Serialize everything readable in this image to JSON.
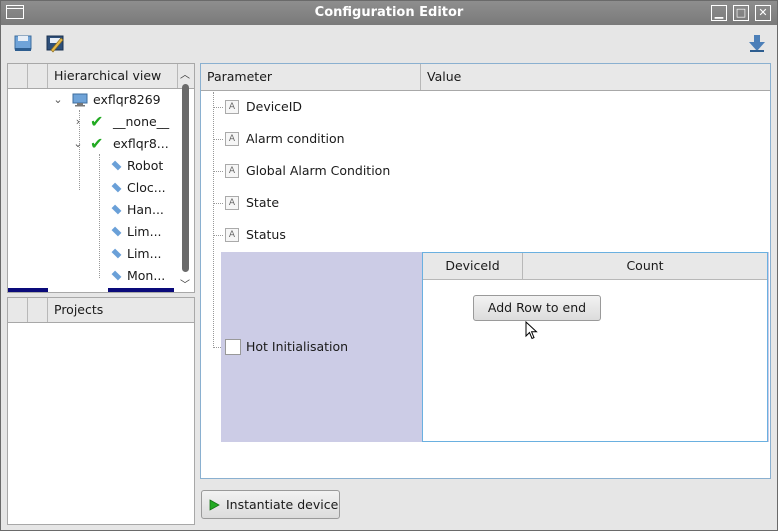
{
  "window": {
    "title": "Configuration Editor",
    "minimize": "▁",
    "maximize": "□",
    "close": "✕"
  },
  "toolbar": {
    "icons": [
      "save-icon",
      "edit-icon",
      "download-arrow-icon"
    ]
  },
  "tree": {
    "header": "Hierarchical view",
    "items": [
      {
        "label": "exflqr8269",
        "icon": "computer-icon",
        "expanded": true
      },
      {
        "label": "__none__",
        "icon": "check-icon",
        "expanded": false
      },
      {
        "label": "exflqr8...",
        "icon": "check-icon",
        "expanded": true
      },
      {
        "label": "Robot",
        "icon": "diamond-icon"
      },
      {
        "label": "Cloc...",
        "icon": "diamond-icon"
      },
      {
        "label": "Han...",
        "icon": "diamond-icon"
      },
      {
        "label": "Lim...",
        "icon": "diamond-icon"
      },
      {
        "label": "Lim...",
        "icon": "diamond-icon"
      },
      {
        "label": "Mon...",
        "icon": "diamond-icon"
      }
    ]
  },
  "projects": {
    "header": "Projects"
  },
  "params": {
    "col_parameter": "Parameter",
    "col_value": "Value",
    "rows": [
      "DeviceID",
      "Alarm condition",
      "Global Alarm Condition",
      "State",
      "Status"
    ],
    "hot_init": "Hot Initialisation",
    "type_badge": "A"
  },
  "subtable": {
    "col_deviceid": "DeviceId",
    "col_count": "Count",
    "add_row": "Add Row to end"
  },
  "footer": {
    "instantiate": "Instantiate device"
  },
  "colors": {
    "highlight": "#cccce6",
    "accent": "#6aa0d8",
    "check": "#22aa22"
  }
}
